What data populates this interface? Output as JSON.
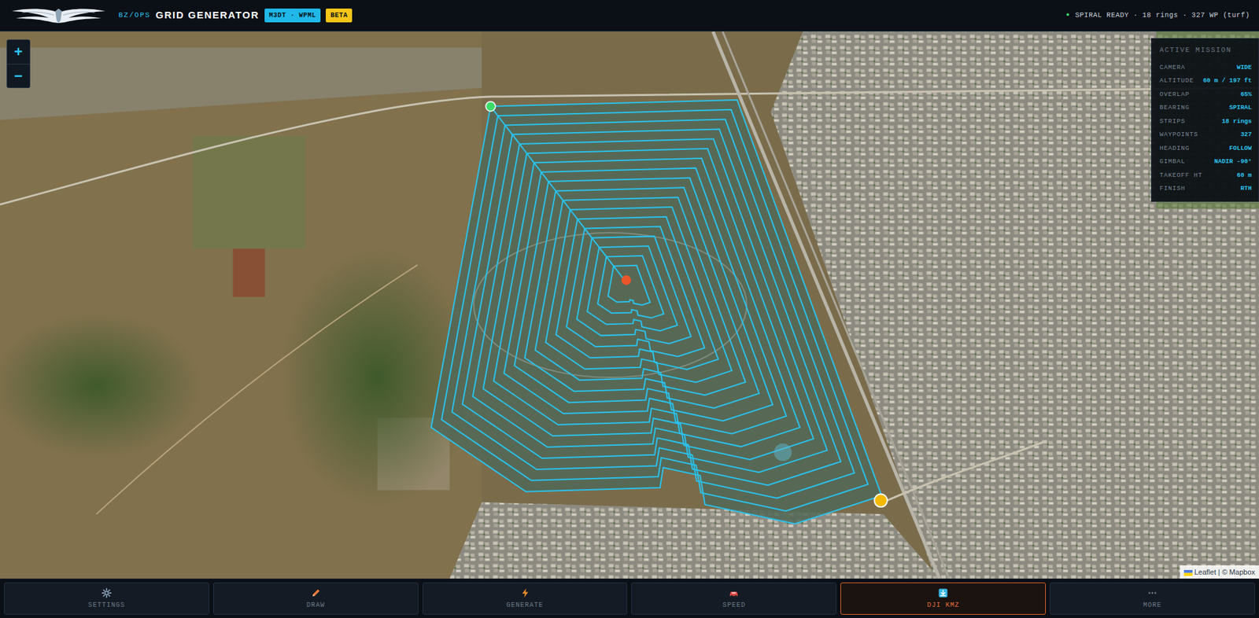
{
  "header": {
    "org": "BZ/OPS",
    "title": "GRID GENERATOR",
    "badges": [
      {
        "label": "M3DT · WPML",
        "color": "#1fb8e8"
      },
      {
        "label": "BETA",
        "color": "#f5c518"
      }
    ],
    "status": {
      "dot": "●",
      "text": "SPIRAL READY · 18 rings · 327 WP (turf)"
    }
  },
  "map": {
    "zoom_in": "+",
    "zoom_out": "−",
    "attribution": "Leaflet | © Mapbox"
  },
  "mission": {
    "title": "ACTIVE MISSION",
    "rows": [
      {
        "label": "CAMERA",
        "value": "WIDE"
      },
      {
        "label": "ALTITUDE",
        "value": "60 m / 197 ft"
      },
      {
        "label": "OVERLAP",
        "value": "65%"
      },
      {
        "label": "BEARING",
        "value": "SPIRAL"
      },
      {
        "label": "STRIPS",
        "value": "18 rings"
      },
      {
        "label": "WAYPOINTS",
        "value": "327"
      },
      {
        "label": "HEADING",
        "value": "FOLLOW"
      },
      {
        "label": "GIMBAL",
        "value": "NADIR -90°"
      },
      {
        "label": "TAKEOFF HT",
        "value": "60 m"
      },
      {
        "label": "FINISH",
        "value": "RTH"
      }
    ]
  },
  "toolbar": [
    {
      "label": "SETTINGS",
      "selected": false
    },
    {
      "label": "DRAW",
      "selected": false
    },
    {
      "label": "GENERATE",
      "selected": false
    },
    {
      "label": "SPEED",
      "selected": false
    },
    {
      "label": "DJI KMZ",
      "selected": true
    },
    {
      "label": "MORE",
      "selected": false
    }
  ]
}
